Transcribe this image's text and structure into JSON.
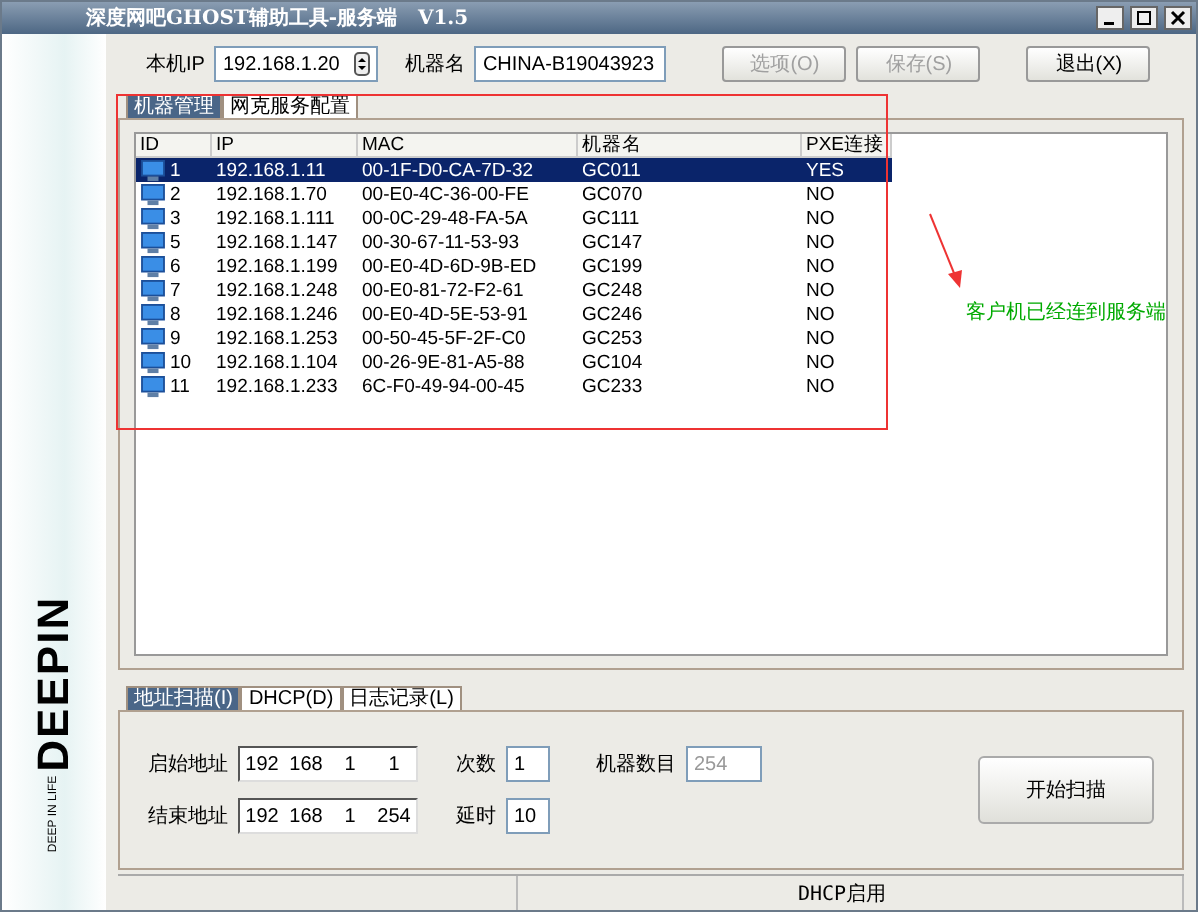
{
  "window": {
    "title": "深度网吧GHOST辅助工具-服务端   V1.5"
  },
  "sidebar": {
    "logo": "DEEPIN",
    "tagline": "DEEP IN LIFE"
  },
  "top_bar": {
    "ip_label": "本机IP",
    "ip_value": "192.168.1.20",
    "name_label": "机器名",
    "name_value": "CHINA-B19043923",
    "buttons": [
      {
        "label": "选项(O)",
        "disabled": true
      },
      {
        "label": "保存(S)",
        "disabled": true
      },
      {
        "label": "退出(X)",
        "disabled": false
      }
    ]
  },
  "tabs": [
    {
      "label": "机器管理",
      "selected": true
    },
    {
      "label": "网克服务配置",
      "selected": false
    }
  ],
  "table": {
    "columns": [
      "ID",
      "IP",
      "MAC",
      "机器名",
      "PXE连接"
    ],
    "rows": [
      {
        "cells": [
          "1",
          "192.168.1.11",
          "00-1F-D0-CA-7D-32",
          "GC011",
          "YES"
        ],
        "selected": true
      },
      {
        "cells": [
          "2",
          "192.168.1.70",
          "00-E0-4C-36-00-FE",
          "GC070",
          "NO"
        ],
        "selected": false
      },
      {
        "cells": [
          "3",
          "192.168.1.111",
          "00-0C-29-48-FA-5A",
          "GC111",
          "NO"
        ],
        "selected": false
      },
      {
        "cells": [
          "5",
          "192.168.1.147",
          "00-30-67-11-53-93",
          "GC147",
          "NO"
        ],
        "selected": false
      },
      {
        "cells": [
          "6",
          "192.168.1.199",
          "00-E0-4D-6D-9B-ED",
          "GC199",
          "NO"
        ],
        "selected": false
      },
      {
        "cells": [
          "7",
          "192.168.1.248",
          "00-E0-81-72-F2-61",
          "GC248",
          "NO"
        ],
        "selected": false
      },
      {
        "cells": [
          "8",
          "192.168.1.246",
          "00-E0-4D-5E-53-91",
          "GC246",
          "NO"
        ],
        "selected": false
      },
      {
        "cells": [
          "9",
          "192.168.1.253",
          "00-50-45-5F-2F-C0",
          "GC253",
          "NO"
        ],
        "selected": false
      },
      {
        "cells": [
          "10",
          "192.168.1.104",
          "00-26-9E-81-A5-88",
          "GC104",
          "NO"
        ],
        "selected": false
      },
      {
        "cells": [
          "11",
          "192.168.1.233",
          "6C-F0-49-94-00-45",
          "GC233",
          "NO"
        ],
        "selected": false
      }
    ]
  },
  "annotation": {
    "text": "客户机已经连到服务端"
  },
  "bottom_tabs": [
    {
      "label": "地址扫描(I)",
      "selected": true
    },
    {
      "label": "DHCP(D)",
      "selected": false
    },
    {
      "label": "日志记录(L)",
      "selected": false
    }
  ],
  "scan": {
    "start_label": "启始地址",
    "start_address": [
      "192",
      "168",
      "1",
      "1"
    ],
    "count_label": "次数",
    "count_value": "1",
    "machines_label": "机器数目",
    "machines_value": "254",
    "machines_disabled": true,
    "end_label": "结束地址",
    "end_address": [
      "192",
      "168",
      "1",
      "254"
    ],
    "delay_label": "延时",
    "delay_value": "10",
    "scan_button": "开始扫描"
  },
  "status_bar": {
    "text": "DHCP启用"
  }
}
